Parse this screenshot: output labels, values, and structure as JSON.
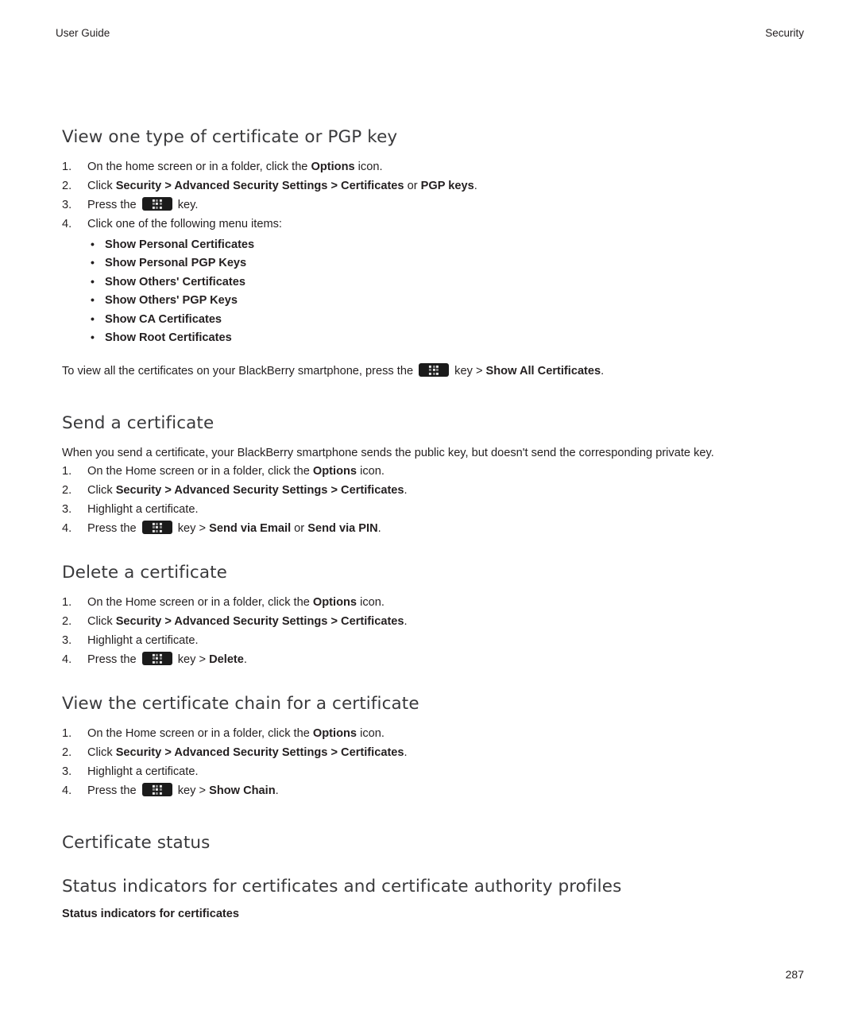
{
  "header": {
    "left": "User Guide",
    "right": "Security"
  },
  "footer": {
    "page_number": "287"
  },
  "sections": [
    {
      "title": "View one type of certificate or PGP key",
      "steps": [
        "On the home screen or in a folder, click the Options icon.",
        "Click Security > Advanced Security Settings > Certificates or PGP keys.",
        "Press the [menu] key.",
        "Click one of the following menu items:"
      ],
      "bullets": [
        "Show Personal Certificates",
        "Show Personal PGP Keys",
        "Show Others' Certificates",
        "Show Others' PGP Keys",
        "Show CA Certificates",
        "Show Root Certificates"
      ],
      "note": "To view all the certificates on your BlackBerry smartphone, press the [menu] key > Show All Certificates."
    },
    {
      "title": "Send a certificate",
      "intro": "When you send a certificate, your BlackBerry smartphone sends the public key, but doesn't send the corresponding private key.",
      "steps": [
        "On the Home screen or in a folder, click the Options icon.",
        "Click Security > Advanced Security Settings > Certificates.",
        "Highlight a certificate.",
        "Press the [menu] key > Send via Email or Send via PIN."
      ]
    },
    {
      "title": "Delete a certificate",
      "steps": [
        "On the Home screen or in a folder, click the Options icon.",
        "Click Security > Advanced Security Settings > Certificates.",
        "Highlight a certificate.",
        "Press the [menu] key > Delete."
      ]
    },
    {
      "title": "View the certificate chain for a certificate",
      "steps": [
        "On the Home screen or in a folder, click the Options icon.",
        "Click Security > Advanced Security Settings > Certificates.",
        "Highlight a certificate.",
        "Press the [menu] key > Show Chain."
      ]
    },
    {
      "title": "Certificate status"
    },
    {
      "title": "Status indicators for certificates and certificate authority profiles",
      "subheading": "Status indicators for certificates"
    }
  ],
  "text": {
    "s1_step1_a": "On the home screen or in a folder, click the ",
    "s1_step1_b": "Options",
    "s1_step1_c": " icon.",
    "s1_step2_a": "Click ",
    "s1_step2_b": "Security",
    "s1_step2_c": " > ",
    "s1_step2_d": "Advanced Security Settings",
    "s1_step2_e": " > ",
    "s1_step2_f": "Certificates",
    "s1_step2_g": " or ",
    "s1_step2_h": "PGP keys",
    "s1_step2_i": ".",
    "s1_step3_a": "Press the ",
    "s1_step3_b": " key.",
    "s1_step4": "Click one of the following menu items:",
    "s1_note_a": "To view all the certificates on your BlackBerry smartphone, press the ",
    "s1_note_b": " key > ",
    "s1_note_c": "Show All Certificates",
    "s1_note_d": ".",
    "s2_intro": "When you send a certificate, your BlackBerry smartphone sends the public key, but doesn't send the corresponding private key.",
    "home_step_a": "On the Home screen or in a folder, click the ",
    "home_step_b": "Options",
    "home_step_c": " icon.",
    "click_sec_a": "Click ",
    "click_sec_b": "Security",
    "click_sec_c": " > ",
    "click_sec_d": "Advanced Security Settings",
    "click_sec_e": " > ",
    "click_sec_f": "Certificates",
    "click_sec_g": ".",
    "highlight_cert": "Highlight a certificate.",
    "press_a": "Press the ",
    "press_key_gt": " key > ",
    "send_via_email": "Send via Email",
    "or_text": " or ",
    "send_via_pin": "Send via PIN",
    "period": ".",
    "delete_label": "Delete",
    "show_chain_label": "Show Chain"
  }
}
